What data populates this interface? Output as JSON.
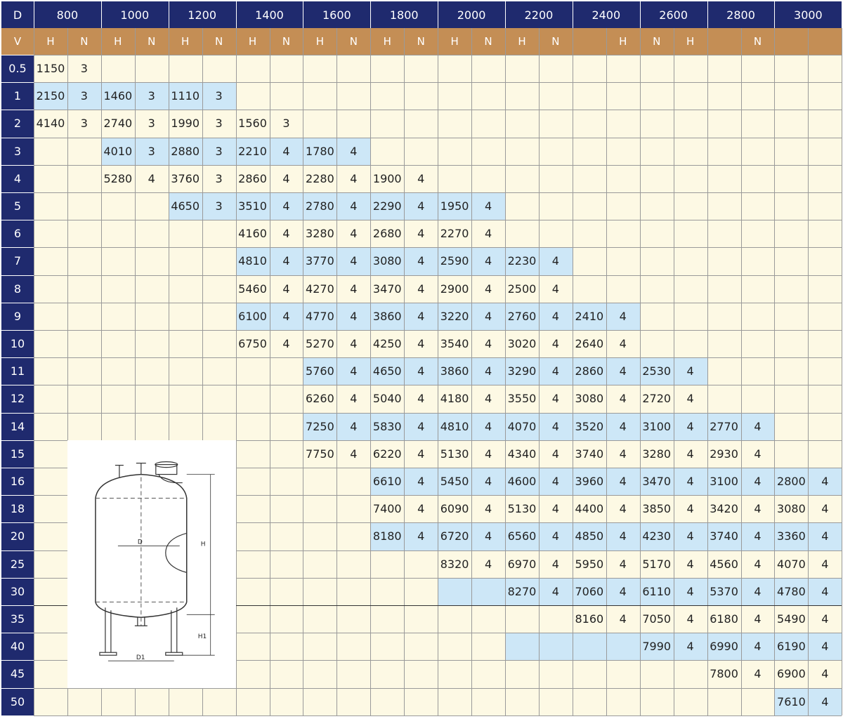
{
  "table": {
    "corner_top": "D",
    "corner_sub": "V",
    "diameters": [
      "800",
      "1000",
      "1200",
      "1400",
      "1600",
      "1800",
      "2000",
      "2200",
      "2400",
      "2600",
      "2800",
      "3000"
    ],
    "subheaders": [
      "H",
      "N",
      "H",
      "N",
      "H",
      "N",
      "H",
      "N",
      "H",
      "N",
      "H",
      "N",
      "H",
      "N",
      "H",
      "N",
      "",
      "H",
      "N",
      "H",
      "",
      "N",
      "",
      ""
    ],
    "volumes": [
      "0.5",
      "1",
      "2",
      "3",
      "4",
      "5",
      "6",
      "7",
      "8",
      "9",
      "10",
      "11",
      "12",
      "14",
      "15",
      "16",
      "18",
      "20",
      "25",
      "30",
      "35",
      "40",
      "45",
      "50"
    ],
    "rows": [
      [
        "1150",
        "3",
        "",
        "",
        "",
        "",
        "",
        "",
        "",
        "",
        "",
        "",
        "",
        "",
        "",
        "",
        "",
        "",
        "",
        "",
        "",
        "",
        "",
        ""
      ],
      [
        "2150",
        "3",
        "1460",
        "3",
        "1110",
        "3",
        "",
        "",
        "",
        "",
        "",
        "",
        "",
        "",
        "",
        "",
        "",
        "",
        "",
        "",
        "",
        "",
        "",
        ""
      ],
      [
        "4140",
        "3",
        "2740",
        "3",
        "1990",
        "3",
        "1560",
        "3",
        "",
        "",
        "",
        "",
        "",
        "",
        "",
        "",
        "",
        "",
        "",
        "",
        "",
        "",
        "",
        ""
      ],
      [
        "",
        "",
        "4010",
        "3",
        "2880",
        "3",
        "2210",
        "4",
        "1780",
        "4",
        "",
        "",
        "",
        "",
        "",
        "",
        "",
        "",
        "",
        "",
        "",
        "",
        "",
        ""
      ],
      [
        "",
        "",
        "5280",
        "4",
        "3760",
        "3",
        "2860",
        "4",
        "2280",
        "4",
        "1900",
        "4",
        "",
        "",
        "",
        "",
        "",
        "",
        "",
        "",
        "",
        "",
        "",
        ""
      ],
      [
        "",
        "",
        "",
        "",
        "4650",
        "3",
        "3510",
        "4",
        "2780",
        "4",
        "2290",
        "4",
        "1950",
        "4",
        "",
        "",
        "",
        "",
        "",
        "",
        "",
        "",
        "",
        ""
      ],
      [
        "",
        "",
        "",
        "",
        "",
        "",
        "4160",
        "4",
        "3280",
        "4",
        "2680",
        "4",
        "2270",
        "4",
        "",
        "",
        "",
        "",
        "",
        "",
        "",
        "",
        "",
        ""
      ],
      [
        "",
        "",
        "",
        "",
        "",
        "",
        "4810",
        "4",
        "3770",
        "4",
        "3080",
        "4",
        "2590",
        "4",
        "2230",
        "4",
        "",
        "",
        "",
        "",
        "",
        "",
        "",
        ""
      ],
      [
        "",
        "",
        "",
        "",
        "",
        "",
        "5460",
        "4",
        "4270",
        "4",
        "3470",
        "4",
        "2900",
        "4",
        "2500",
        "4",
        "",
        "",
        "",
        "",
        "",
        "",
        "",
        ""
      ],
      [
        "",
        "",
        "",
        "",
        "",
        "",
        "6100",
        "4",
        "4770",
        "4",
        "3860",
        "4",
        "3220",
        "4",
        "2760",
        "4",
        "2410",
        "4",
        "",
        "",
        "",
        "",
        "",
        ""
      ],
      [
        "",
        "",
        "",
        "",
        "",
        "",
        "6750",
        "4",
        "5270",
        "4",
        "4250",
        "4",
        "3540",
        "4",
        "3020",
        "4",
        "2640",
        "4",
        "",
        "",
        "",
        "",
        "",
        ""
      ],
      [
        "",
        "",
        "",
        "",
        "",
        "",
        "",
        "",
        "5760",
        "4",
        "4650",
        "4",
        "3860",
        "4",
        "3290",
        "4",
        "2860",
        "4",
        "2530",
        "4",
        "",
        "",
        "",
        ""
      ],
      [
        "",
        "",
        "",
        "",
        "",
        "",
        "",
        "",
        "6260",
        "4",
        "5040",
        "4",
        "4180",
        "4",
        "3550",
        "4",
        "3080",
        "4",
        "2720",
        "4",
        "",
        "",
        "",
        ""
      ],
      [
        "",
        "",
        "",
        "",
        "",
        "",
        "",
        "",
        "7250",
        "4",
        "5830",
        "4",
        "4810",
        "4",
        "4070",
        "4",
        "3520",
        "4",
        "3100",
        "4",
        "2770",
        "4",
        "",
        ""
      ],
      [
        "",
        "",
        "",
        "",
        "",
        "",
        "",
        "",
        "7750",
        "4",
        "6220",
        "4",
        "5130",
        "4",
        "4340",
        "4",
        "3740",
        "4",
        "3280",
        "4",
        "2930",
        "4",
        "",
        ""
      ],
      [
        "",
        "",
        "",
        "",
        "",
        "",
        "",
        "",
        "",
        "",
        "6610",
        "4",
        "5450",
        "4",
        "4600",
        "4",
        "3960",
        "4",
        "3470",
        "4",
        "3100",
        "4",
        "2800",
        "4"
      ],
      [
        "",
        "",
        "",
        "",
        "",
        "",
        "",
        "",
        "",
        "",
        "7400",
        "4",
        "6090",
        "4",
        "5130",
        "4",
        "4400",
        "4",
        "3850",
        "4",
        "3420",
        "4",
        "3080",
        "4"
      ],
      [
        "",
        "",
        "",
        "",
        "",
        "",
        "",
        "",
        "",
        "",
        "8180",
        "4",
        "6720",
        "4",
        "6560",
        "4",
        "4850",
        "4",
        "4230",
        "4",
        "3740",
        "4",
        "3360",
        "4"
      ],
      [
        "",
        "",
        "",
        "",
        "",
        "",
        "",
        "",
        "",
        "",
        "",
        "",
        "8320",
        "4",
        "6970",
        "4",
        "5950",
        "4",
        "5170",
        "4",
        "4560",
        "4",
        "4070",
        "4"
      ],
      [
        "",
        "",
        "",
        "",
        "",
        "",
        "",
        "",
        "",
        "",
        "",
        "",
        "",
        "",
        "8270",
        "4",
        "7060",
        "4",
        "6110",
        "4",
        "5370",
        "4",
        "4780",
        "4"
      ],
      [
        "",
        "",
        "",
        "",
        "",
        "",
        "",
        "",
        "",
        "",
        "",
        "",
        "",
        "",
        "",
        "",
        "8160",
        "4",
        "7050",
        "4",
        "6180",
        "4",
        "5490",
        "4"
      ],
      [
        "",
        "",
        "",
        "",
        "",
        "",
        "",
        "",
        "",
        "",
        "",
        "",
        "",
        "",
        "",
        "",
        "",
        "",
        "7990",
        "4",
        "6990",
        "4",
        "6190",
        "4"
      ],
      [
        "",
        "",
        "",
        "",
        "",
        "",
        "",
        "",
        "",
        "",
        "",
        "",
        "",
        "",
        "",
        "",
        "",
        "",
        "",
        "",
        "7800",
        "4",
        "6900",
        "4"
      ],
      [
        "",
        "",
        "",
        "",
        "",
        "",
        "",
        "",
        "",
        "",
        "",
        "",
        "",
        "",
        "",
        "",
        "",
        "",
        "",
        "",
        "",
        "",
        "7610",
        "4"
      ]
    ],
    "blue_ranges": [
      [],
      [
        0,
        6
      ],
      [],
      [
        2,
        10
      ],
      [],
      [
        4,
        14
      ],
      [],
      [
        6,
        16
      ],
      [],
      [
        6,
        18
      ],
      [],
      [
        8,
        20
      ],
      [],
      [
        8,
        22
      ],
      [],
      [
        10,
        24
      ],
      [],
      [
        10,
        24
      ],
      [],
      [
        12,
        24
      ],
      [],
      [
        14,
        24
      ],
      [],
      [
        22,
        24
      ]
    ]
  },
  "drawing": {
    "label_d": "D",
    "label_h": "H",
    "label_h1": "H1",
    "label_d1": "D1"
  }
}
